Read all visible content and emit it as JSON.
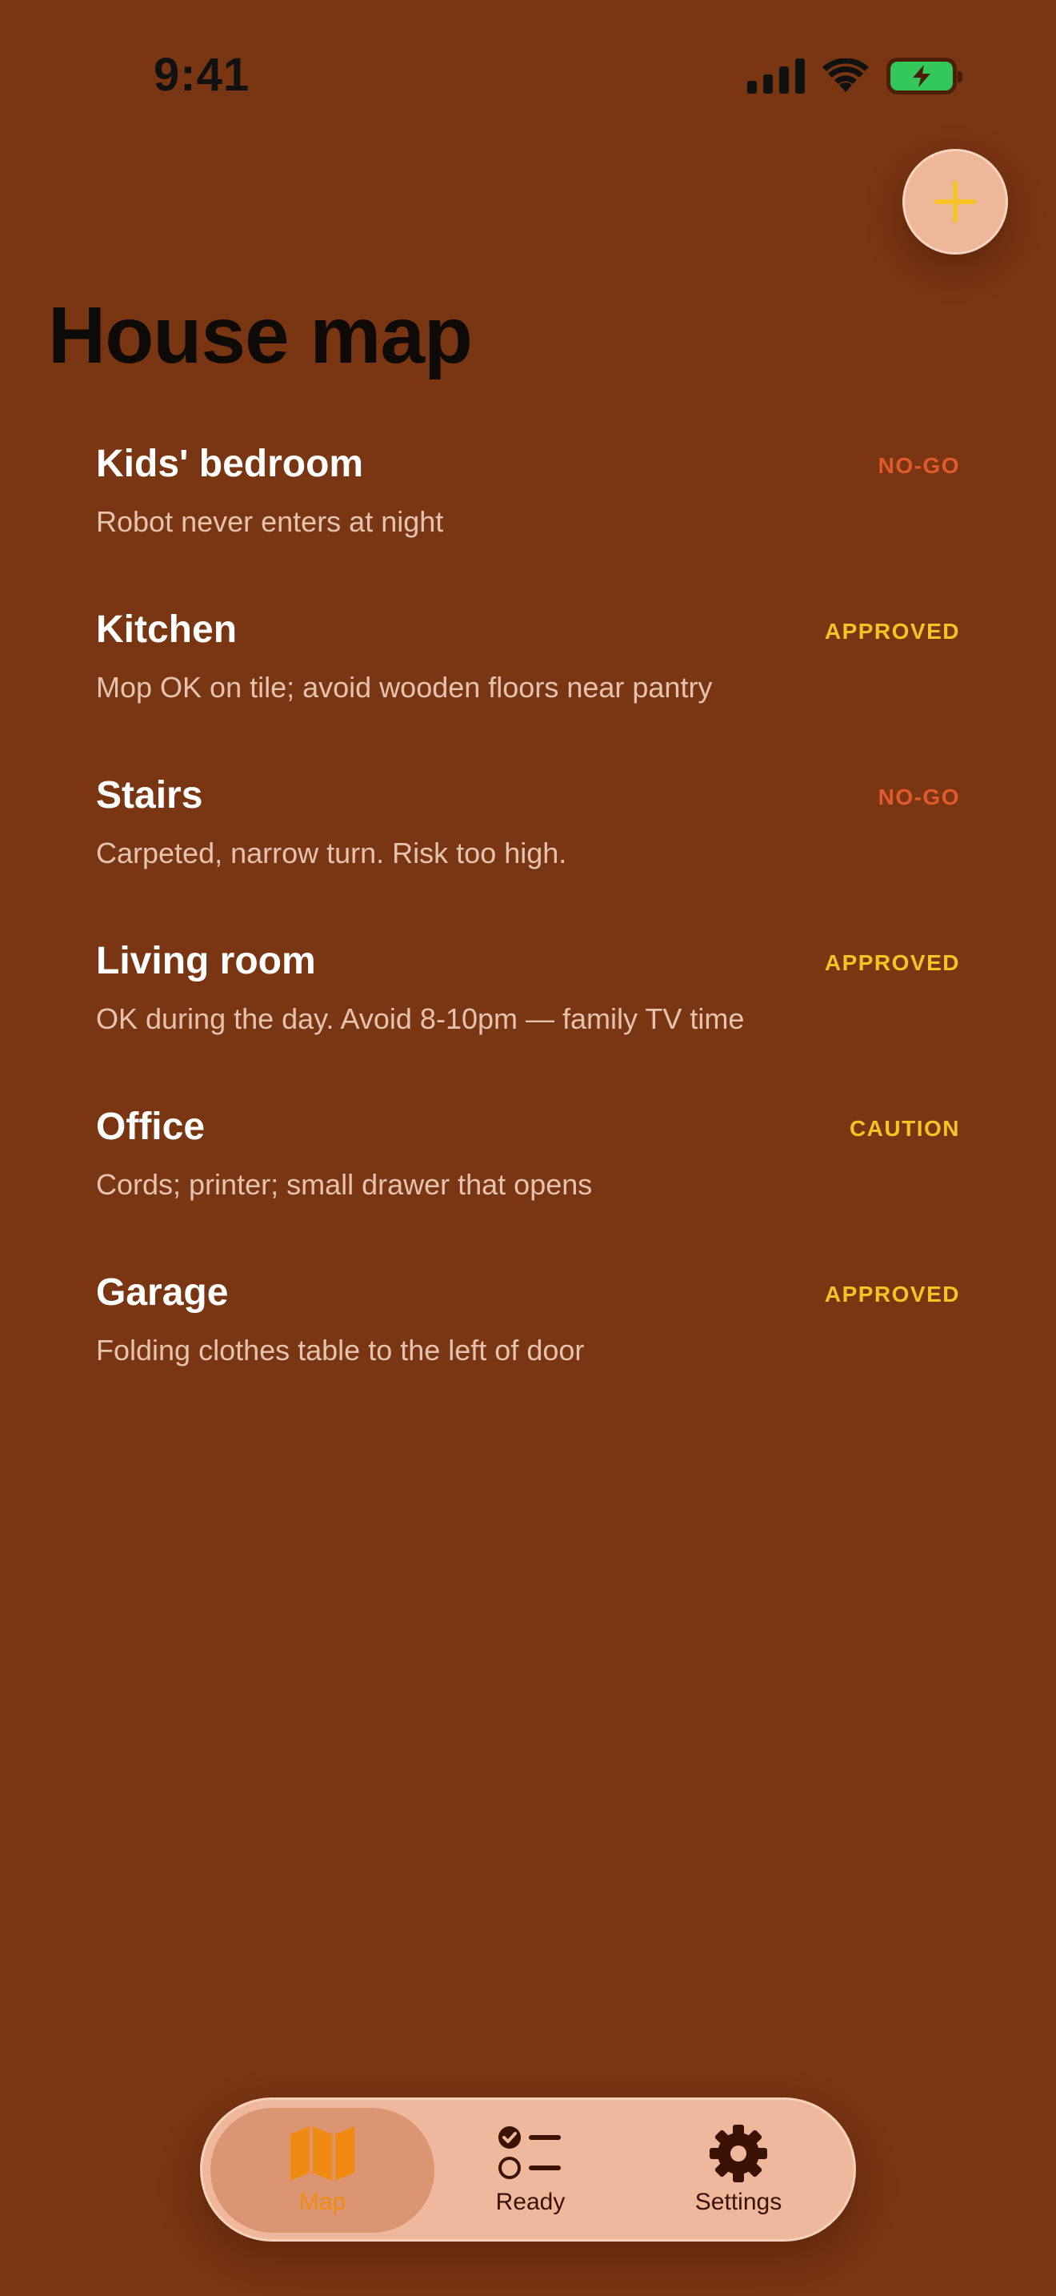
{
  "status_bar": {
    "time": "9:41",
    "icons": [
      "cellular-signal-icon",
      "wifi-icon",
      "battery-charging-icon"
    ]
  },
  "header": {
    "title": "House map",
    "add_button_icon": "plus-icon"
  },
  "colors": {
    "background": "#7a3512",
    "no_go": "#e05a2b",
    "approved": "#f5c324",
    "caution": "#f5c324",
    "tab_active": "#f08a10",
    "tab_inactive": "#3a1306"
  },
  "rooms": [
    {
      "name": "Kids' bedroom",
      "description": "Robot never enters at night",
      "status": "NO-GO"
    },
    {
      "name": "Kitchen",
      "description": "Mop OK on tile; avoid wooden floors near pantry",
      "status": "APPROVED"
    },
    {
      "name": "Stairs",
      "description": "Carpeted, narrow turn. Risk too high.",
      "status": "NO-GO"
    },
    {
      "name": "Living room",
      "description": "OK during the day. Avoid 8-10pm — family TV time",
      "status": "APPROVED"
    },
    {
      "name": "Office",
      "description": "Cords; printer; small drawer that opens",
      "status": "CAUTION"
    },
    {
      "name": "Garage",
      "description": "Folding clothes table to the left of door",
      "status": "APPROVED"
    }
  ],
  "tab_bar": {
    "tabs": [
      {
        "label": "Map",
        "icon": "map-icon",
        "active": true
      },
      {
        "label": "Ready",
        "icon": "checklist-icon",
        "active": false
      },
      {
        "label": "Settings",
        "icon": "gear-icon",
        "active": false
      }
    ]
  }
}
